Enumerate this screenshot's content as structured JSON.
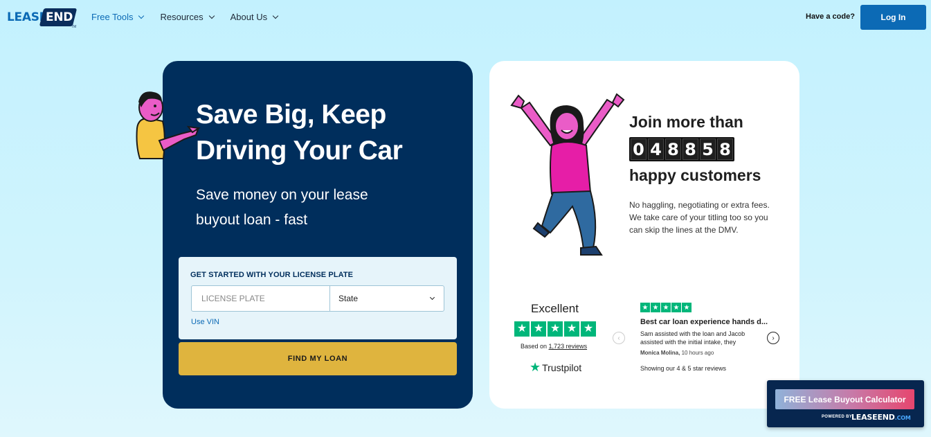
{
  "header": {
    "logo": {
      "lease": "LEASE",
      "end": "END",
      "tm": "TM"
    },
    "nav": [
      {
        "label": "Free Tools"
      },
      {
        "label": "Resources"
      },
      {
        "label": "About Us"
      }
    ],
    "have_code": "Have a code?",
    "login_label": "Log In"
  },
  "hero": {
    "headline": "Save Big, Keep Driving Your Car",
    "subhead": "Save money on your lease buyout loan - fast",
    "plate_form": {
      "title": "GET STARTED WITH YOUR LICENSE PLATE",
      "plate_placeholder": "LICENSE PLATE",
      "state_value": "State",
      "use_vin": "Use VIN"
    },
    "find_button": "FIND MY LOAN"
  },
  "stats": {
    "join": "Join more than",
    "digits": [
      "0",
      "4",
      "8",
      "8",
      "5",
      "8"
    ],
    "happy": "happy customers",
    "description": "No haggling, negotiating or extra fees. We take care of your titling too so you can skip the lines at the DMV."
  },
  "trustpilot": {
    "rating_word": "Excellent",
    "based_on_prefix": "Based on",
    "review_count": "1,723 reviews",
    "logo_text": "Trustpilot",
    "review": {
      "title": "Best car loan experience hands d...",
      "body": "Sam assisted with the loan and Jacob assisted with the initial intake, they",
      "author": "Monica Molina,",
      "time": "10 hours ago"
    },
    "showing": "Showing our 4 & 5 star reviews"
  },
  "widget": {
    "button": "FREE Lease Buyout Calculator",
    "powered_by": "POWERED BY",
    "brand_lease": "LEASE",
    "brand_end": "END",
    "brand_dotcom": ".COM"
  },
  "colors": {
    "primary_blue": "#0c6ab5",
    "navy": "#002e5c",
    "gold": "#dfb43e",
    "trustpilot_green": "#00b67a"
  }
}
